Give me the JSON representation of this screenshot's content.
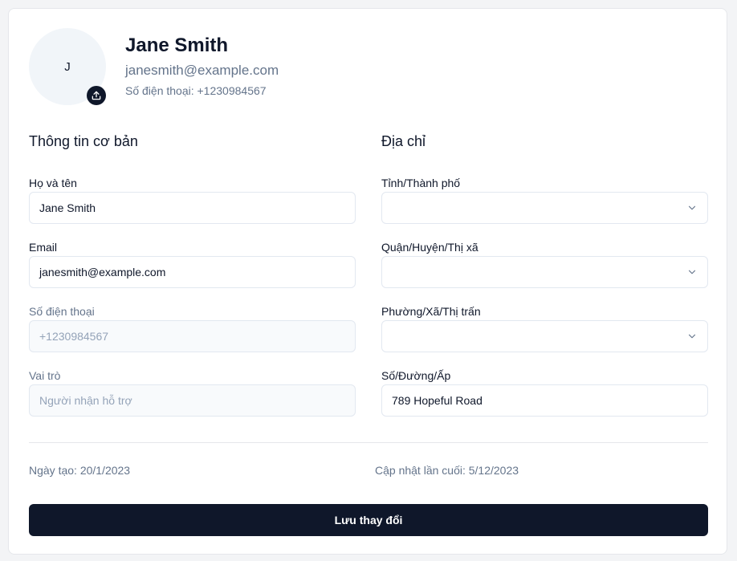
{
  "profile": {
    "avatar_initial": "J",
    "name": "Jane Smith",
    "email": "janesmith@example.com",
    "phone_line": "Số điện thoại: +1230984567"
  },
  "basic_info": {
    "title": "Thông tin cơ bản",
    "full_name": {
      "label": "Họ và tên",
      "value": "Jane Smith"
    },
    "email": {
      "label": "Email",
      "value": "janesmith@example.com"
    },
    "phone": {
      "label": "Số điện thoại",
      "value": "+1230984567"
    },
    "role": {
      "label": "Vai trò",
      "value": "Người nhận hỗ trợ"
    }
  },
  "address": {
    "title": "Địa chỉ",
    "province": {
      "label": "Tỉnh/Thành phố",
      "value": ""
    },
    "district": {
      "label": "Quận/Huyện/Thị xã",
      "value": ""
    },
    "ward": {
      "label": "Phường/Xã/Thị trấn",
      "value": ""
    },
    "street": {
      "label": "Số/Đường/Ấp",
      "value": "789 Hopeful Road"
    }
  },
  "meta": {
    "created": "Ngày tạo: 20/1/2023",
    "updated": "Cập nhật lần cuối: 5/12/2023"
  },
  "actions": {
    "save_label": "Lưu thay đổi"
  },
  "icons": {
    "upload": "upload-icon",
    "chevron": "chevron-down-icon"
  },
  "colors": {
    "primary": "#0f172a",
    "muted_text": "#64748b",
    "border": "#e2e8f0",
    "avatar_bg": "#f1f5f9"
  }
}
